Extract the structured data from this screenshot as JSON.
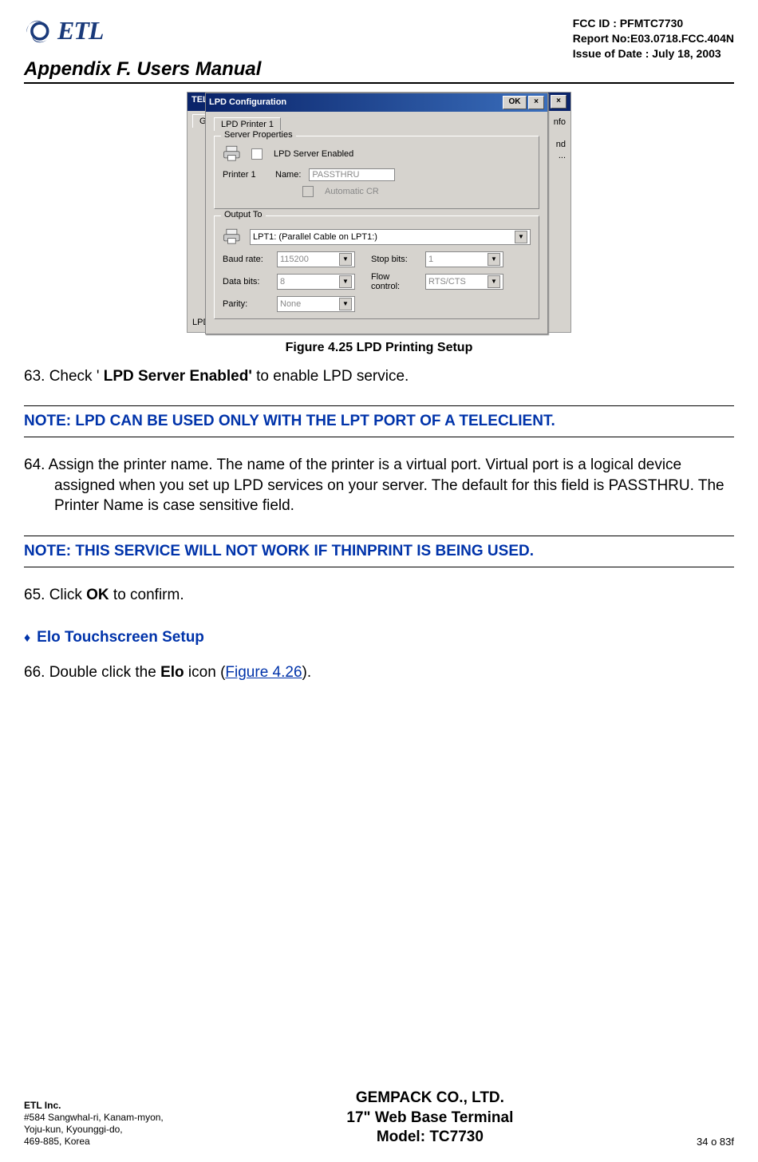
{
  "header": {
    "logo_text": "ETL",
    "fcc_id": "FCC ID : PFMTC7730",
    "report_no": "Report No:E03.0718.FCC.404N",
    "issue_date": "Issue of Date : July 18, 2003",
    "appendix": "Appendix F.  Users Manual"
  },
  "dialog": {
    "bg_title_left": "TELE",
    "bg_tab": "Gene",
    "bg_right_line1": "nfo",
    "bg_right_line2": "nd",
    "bg_right_line3": "...",
    "bg_lpd": "LPD",
    "title": "LPD Configuration",
    "ok": "OK",
    "close": "×",
    "tab": "LPD Printer 1",
    "server_box": "Server Properties",
    "lpd_enabled": "LPD Server Enabled",
    "printer1": "Printer 1",
    "name_label": "Name:",
    "name_value": "PASSTHRU",
    "auto_cr": "Automatic CR",
    "output_box": "Output To",
    "port_value": "LPT1: (Parallel Cable on LPT1:)",
    "baud_label": "Baud rate:",
    "baud_value": "115200",
    "stop_label": "Stop bits:",
    "stop_value": "1",
    "data_label": "Data bits:",
    "data_value": "8",
    "flow_label": "Flow control:",
    "flow_value": "RTS/CTS",
    "parity_label": "Parity:",
    "parity_value": "None"
  },
  "figure_caption": "Figure 4.25       LPD Printing Setup",
  "steps": {
    "s63_pre": "63. Check ' ",
    "s63_bold": "LPD Server Enabled'",
    "s63_post": "  to enable LPD service.",
    "note1": "NOTE: LPD CAN BE USED ONLY WITH THE LPT PORT OF A TELECLIENT.",
    "s64": "64. Assign the printer name.  The name of the printer is a virtual port.  Virtual port is a logical device assigned when you set up LPD services on your server.  The default for this field is PASSTHRU.  The Printer Name is case sensitive field.",
    "note2": "NOTE: THIS SERVICE WILL NOT WORK IF THINPRINT IS BEING USED.",
    "s65_pre": "65. Click ",
    "s65_bold": "OK",
    "s65_post": " to confirm.",
    "sub_heading": "Elo Touchscreen Setup",
    "s66_pre": "66. Double click the ",
    "s66_bold": "Elo",
    "s66_mid": " icon (",
    "s66_link": "Figure 4.26",
    "s66_post": ")."
  },
  "footer": {
    "company": "ETL Inc.",
    "addr1": "#584 Sangwhal-ri, Kanam-myon,",
    "addr2": "Yoju-kun, Kyounggi-do,",
    "addr3": "469-885, Korea",
    "center1": "GEMPACK CO., LTD.",
    "center2": "17\" Web Base Terminal",
    "center3": "Model: TC7730",
    "page": "34 o 83f"
  }
}
